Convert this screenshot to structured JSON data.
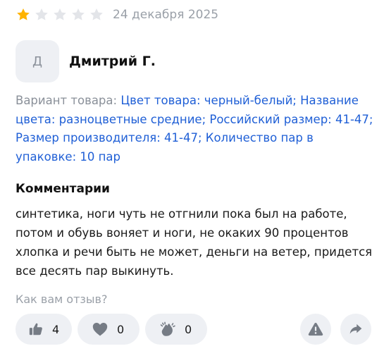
{
  "review": {
    "rating": 1,
    "max_rating": 5,
    "date": "24 декабря 2025",
    "author": {
      "initial": "Д",
      "name": "Дмитрий Г."
    },
    "variant": {
      "label": "Вариант товара:",
      "details": "Цвет товара: черный-белый; Название цвета: разноцветные средние; Российский размер: 41-47; Размер производителя: 41-47; Количество пар в упаковке: 10 пар"
    },
    "comment": {
      "title": "Комментарии",
      "text": "синтетика, ноги чуть не отгнили пока был на работе, потом и обувь воняет и ноги, не окаких 90 процентов хлопка и речи быть не может, деньги на ветер, придется все десять пар выкинуть."
    }
  },
  "feedback": {
    "question": "Как вам отзыв?",
    "like_count": "4",
    "heart_count": "0",
    "clap_count": "0"
  },
  "icons": {
    "star_filled": "star-icon",
    "star_empty": "star-empty-icon",
    "like": "thumbs-up-icon",
    "heart": "heart-icon",
    "clap": "clapping-hands-icon",
    "report": "warning-icon",
    "share": "share-arrow-icon"
  },
  "colors": {
    "star_filled": "#ffb300",
    "star_empty": "#e3e5e9",
    "link_blue": "#1f5fd6",
    "muted_gray": "#9aa0a8",
    "pill_bg": "#eef0f4",
    "icon_gray": "#767c85"
  }
}
